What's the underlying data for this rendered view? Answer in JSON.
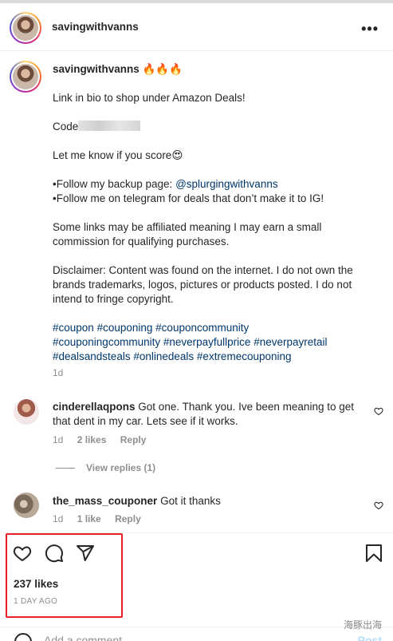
{
  "post": {
    "author": "savingwithvanns",
    "more_icon": "more-horizontal-icon"
  },
  "caption": {
    "author": "savingwithvanns",
    "emoji": "🔥🔥🔥",
    "line1": "Link in bio to shop under Amazon Deals!",
    "code_label": "Code",
    "score_text": "Let me know if you score",
    "score_emoji": "😍",
    "follow_backup_prefix": "•Follow my backup page: ",
    "follow_backup_handle": "@splurgingwithvanns",
    "follow_telegram": "•Follow me on telegram for deals that don’t make it to IG!",
    "affiliate": "Some links may be affiliated meaning I may earn a small commission for qualifying purchases.",
    "disclaimer": "Disclaimer: Content was found on the internet. I do not own the brands trademarks, logos, pictures or products posted. I do not intend to fringe copyright.",
    "hashtags": [
      "#coupon",
      "#couponing",
      "#couponcommunity",
      "#couponingcommunity",
      "#neverpayfullprice",
      "#neverpayretail",
      "#dealsandsteals",
      "#onlinedeals",
      "#extremecouponing"
    ],
    "age": "1d"
  },
  "comments": [
    {
      "user": "cinderellaqpons",
      "text": "Got one. Thank you. Ive been meaning to get that dent in my car. Lets see if it works.",
      "age": "1d",
      "likes": "2 likes",
      "reply": "Reply",
      "view_replies": "View replies (1)"
    },
    {
      "user": "the_mass_couponer",
      "text": "Got it thanks",
      "age": "1d",
      "likes": "1 like",
      "reply": "Reply"
    }
  ],
  "actions": {
    "likes": "237 likes",
    "time": "1 DAY AGO",
    "icons": [
      "heart-icon",
      "comment-icon",
      "share-icon",
      "bookmark-icon"
    ]
  },
  "add_comment": {
    "placeholder": "Add a comment...",
    "post_label": "Post"
  },
  "watermark": "海豚出海",
  "colors": {
    "link": "#00376b",
    "muted": "#8e8e8e",
    "highlight": "#e8202a"
  }
}
